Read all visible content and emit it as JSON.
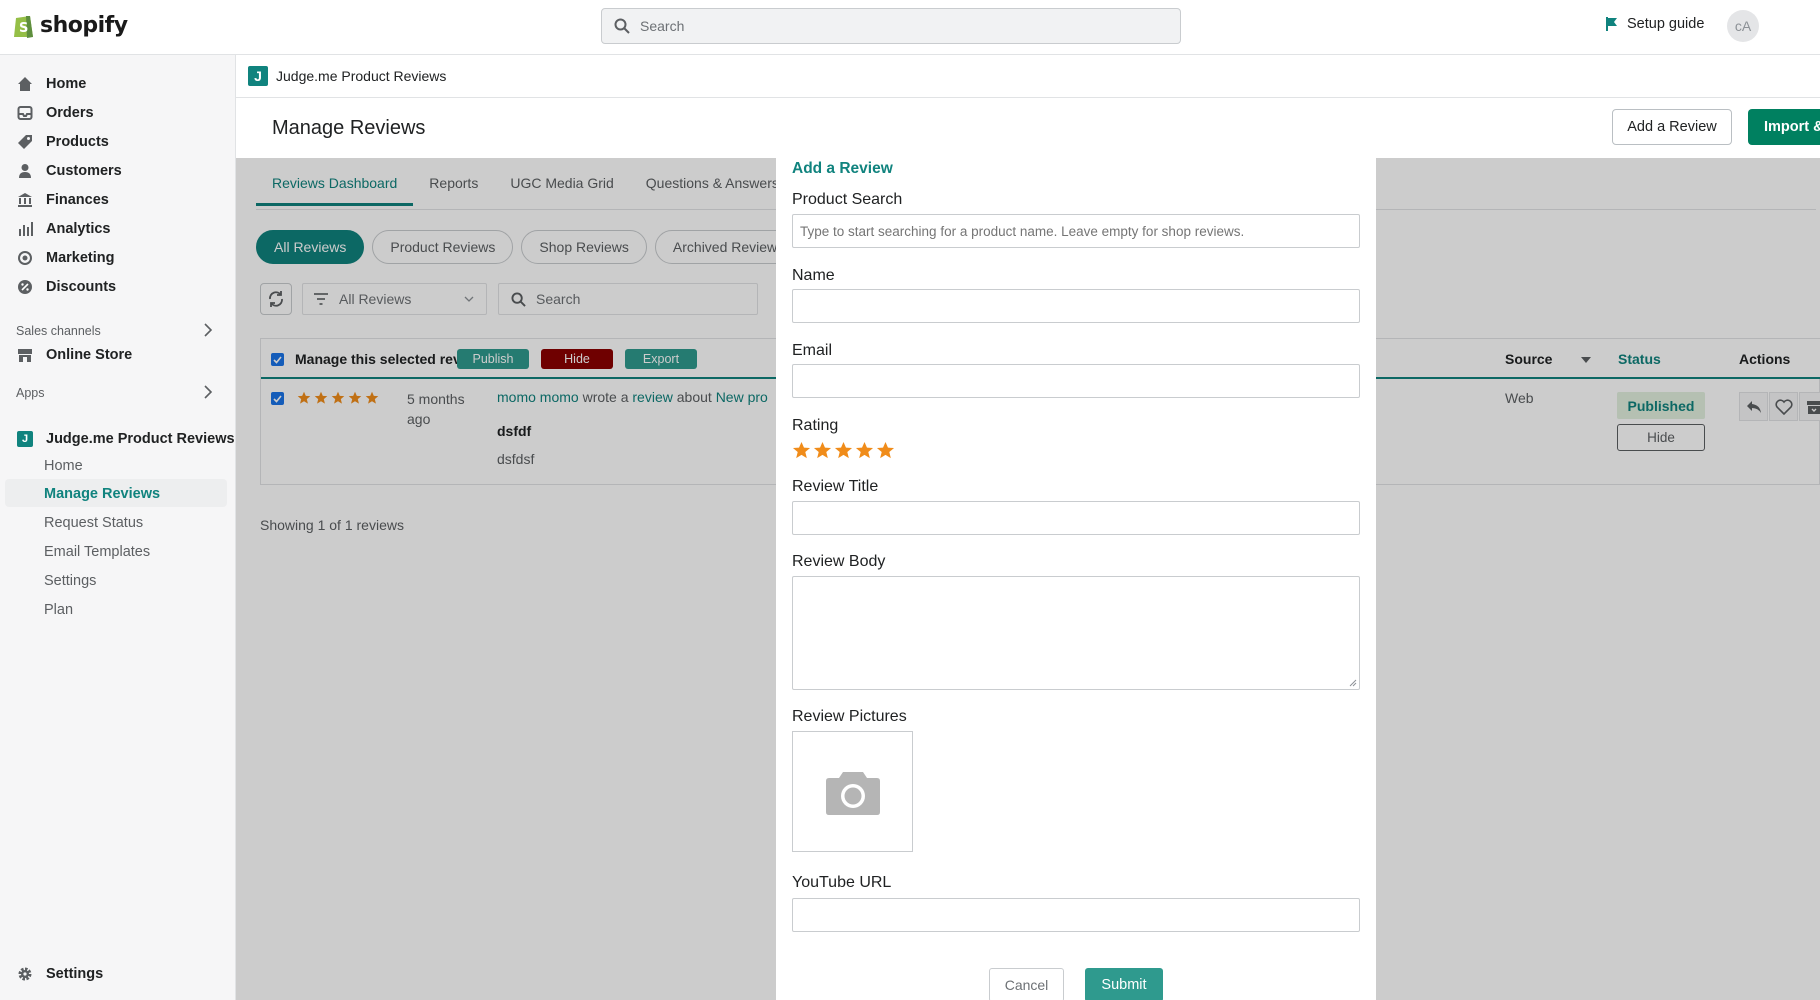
{
  "topbar": {
    "logo_text": "shopify",
    "search_placeholder": "Search",
    "setup_guide": "Setup guide",
    "avatar_initials": "cA"
  },
  "sidebar": {
    "items": [
      {
        "label": "Home",
        "icon": "home-icon"
      },
      {
        "label": "Orders",
        "icon": "orders-icon"
      },
      {
        "label": "Products",
        "icon": "tag-icon"
      },
      {
        "label": "Customers",
        "icon": "person-icon"
      },
      {
        "label": "Finances",
        "icon": "bank-icon"
      },
      {
        "label": "Analytics",
        "icon": "bar-chart-icon"
      },
      {
        "label": "Marketing",
        "icon": "target-icon"
      },
      {
        "label": "Discounts",
        "icon": "discount-icon"
      }
    ],
    "sales_channels_label": "Sales channels",
    "online_store": "Online Store",
    "apps_label": "Apps",
    "app_name": "Judge.me Product Reviews",
    "app_items": [
      "Home",
      "Manage Reviews",
      "Request Status",
      "Email Templates",
      "Settings",
      "Plan"
    ],
    "active_app_item": "Manage Reviews",
    "settings": "Settings"
  },
  "app": {
    "breadcrumb": "Judge.me Product Reviews",
    "app_icon_letter": "J",
    "page_title": "Manage Reviews",
    "add_review_button": "Add a Review",
    "import_button": "Import &",
    "tabs": [
      "Reviews Dashboard",
      "Reports",
      "UGC Media Grid",
      "Questions & Answers"
    ],
    "pills": [
      "All Reviews",
      "Product Reviews",
      "Shop Reviews",
      "Archived Reviews"
    ],
    "filter_value": "All Reviews",
    "search_placeholder": "Search",
    "table": {
      "manage_label": "Manage this selected review",
      "publish": "Publish",
      "hide": "Hide",
      "export": "Export",
      "col_source": "Source",
      "col_status": "Status",
      "col_actions": "Actions",
      "row": {
        "rating": 5,
        "time_line1": "5 months",
        "time_line2": "ago",
        "author": "momo momo",
        "wrote": " wrote a ",
        "review_link": "review",
        "about": " about ",
        "product": "New pro",
        "title": "dsfdf",
        "body": "dsfdsf",
        "source": "Web",
        "status": "Published",
        "hide_button": "Hide"
      }
    },
    "showing": "Showing 1 of 1 reviews"
  },
  "modal": {
    "title": "Add a Review",
    "product_search_label": "Product Search",
    "product_search_placeholder": "Type to start searching for a product name. Leave empty for shop reviews.",
    "name_label": "Name",
    "email_label": "Email",
    "rating_label": "Rating",
    "rating_value": 5,
    "review_title_label": "Review Title",
    "review_body_label": "Review Body",
    "review_pictures_label": "Review Pictures",
    "youtube_label": "YouTube URL",
    "cancel": "Cancel",
    "submit": "Submit"
  },
  "colors": {
    "brand_teal": "#10837e",
    "shopify_green": "#008060",
    "hide_red": "#8b0000",
    "star_orange": "#f08c1a"
  }
}
